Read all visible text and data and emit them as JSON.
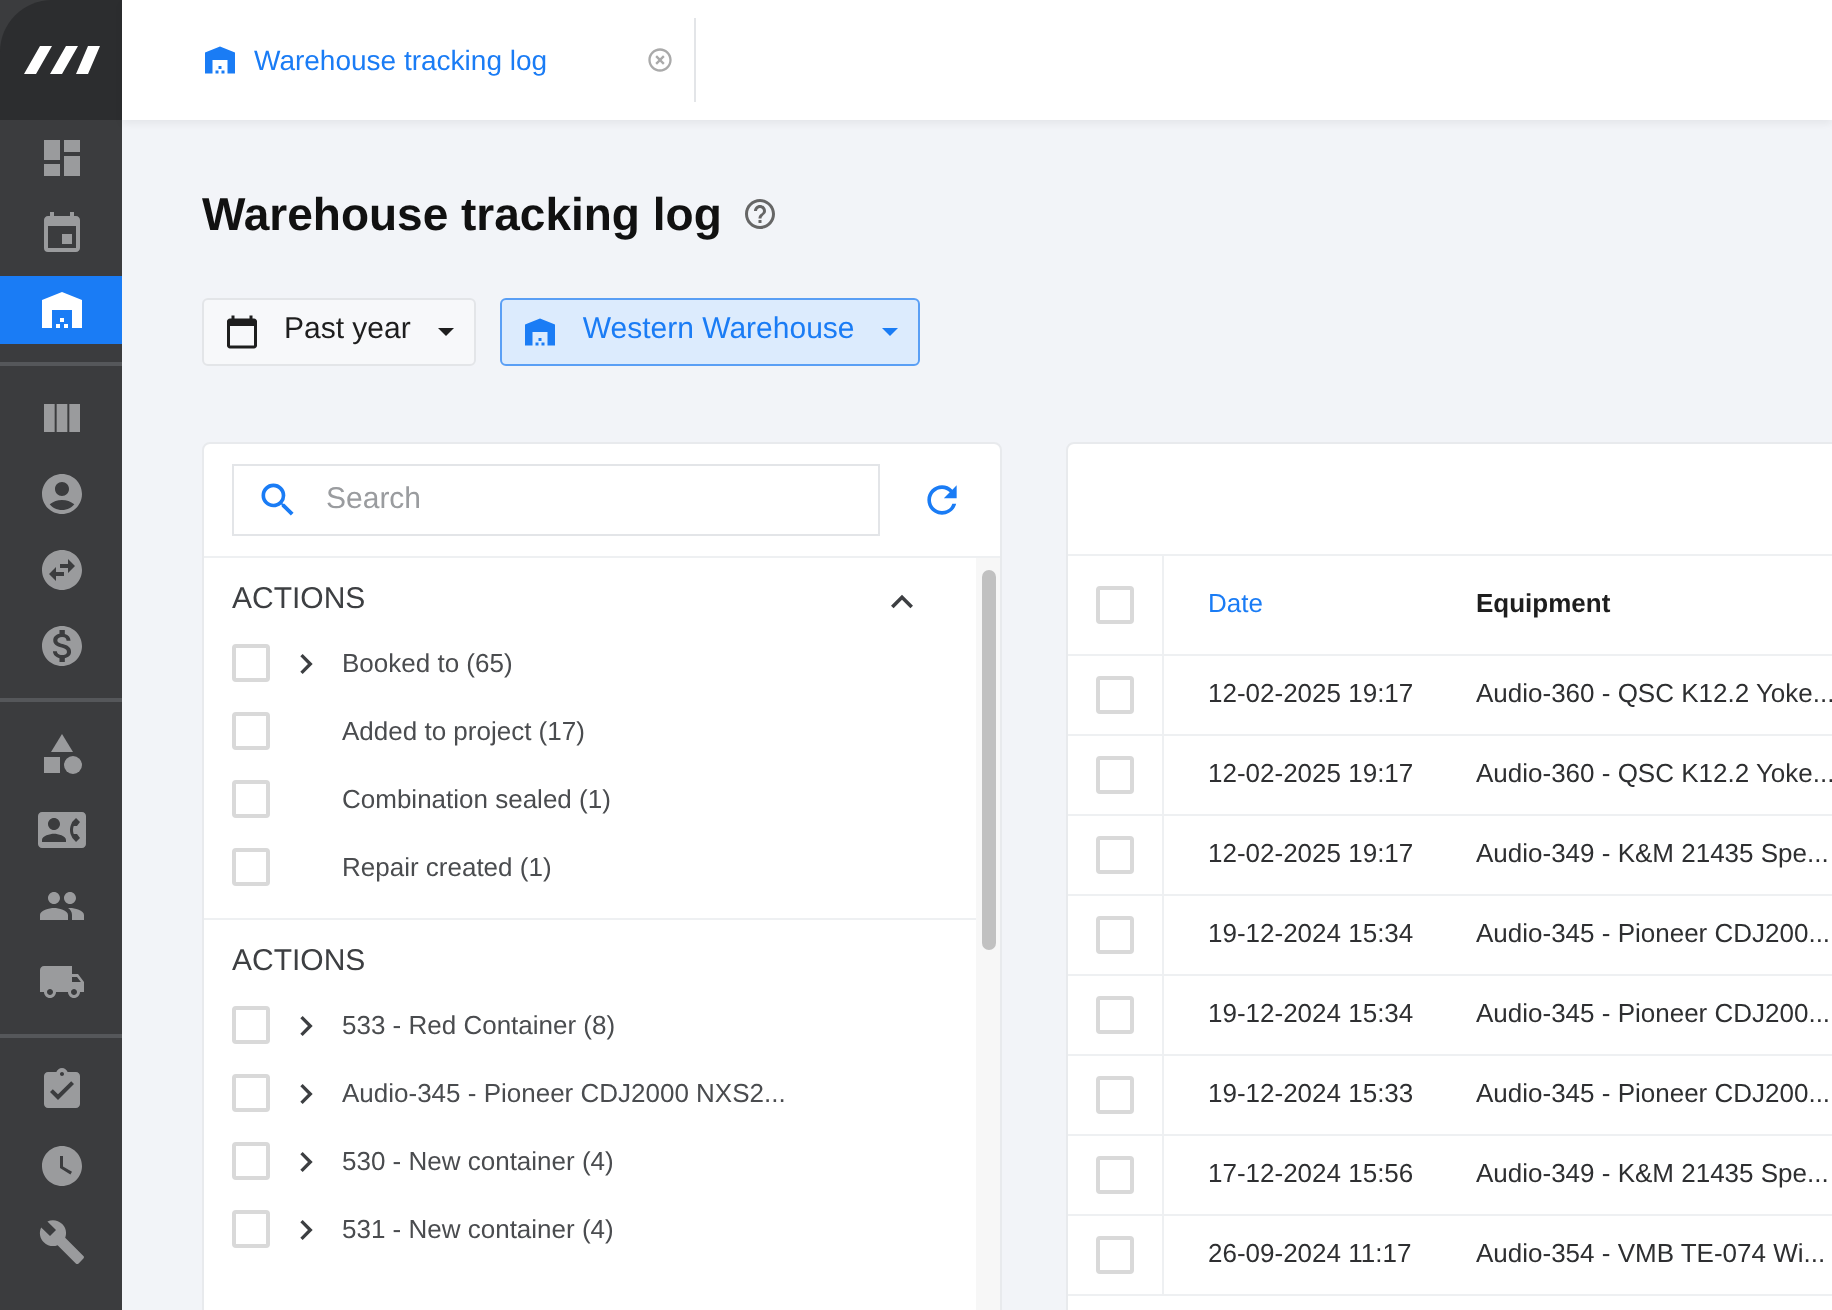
{
  "sidebar": {
    "items": [
      {
        "kind": "dashboard",
        "selected": false
      },
      {
        "kind": "calendar",
        "selected": false
      },
      {
        "kind": "warehouse",
        "selected": true
      },
      {
        "kind": "divider"
      },
      {
        "kind": "columns",
        "selected": false
      },
      {
        "kind": "account",
        "selected": false
      },
      {
        "kind": "swap",
        "selected": false
      },
      {
        "kind": "dollar",
        "selected": false
      },
      {
        "kind": "divider"
      },
      {
        "kind": "shapes",
        "selected": false
      },
      {
        "kind": "contact",
        "selected": false
      },
      {
        "kind": "people",
        "selected": false
      },
      {
        "kind": "truck",
        "selected": false
      },
      {
        "kind": "divider"
      },
      {
        "kind": "clipboard",
        "selected": false
      },
      {
        "kind": "clock",
        "selected": false
      },
      {
        "kind": "wrench",
        "selected": false
      }
    ]
  },
  "tabs": [
    {
      "label": "Warehouse tracking log",
      "selected": true
    }
  ],
  "page": {
    "title": "Warehouse tracking log"
  },
  "filters": [
    {
      "kind": "period",
      "label": "Past year",
      "selected": false
    },
    {
      "kind": "warehouse",
      "label": "Western Warehouse",
      "selected": true
    }
  ],
  "filter_panel": {
    "search": {
      "placeholder": "Search"
    },
    "sections": [
      {
        "title": "ACTIONS",
        "expanded": true,
        "items": [
          {
            "label": "Booked to (65)",
            "checked": false,
            "expandable": true
          },
          {
            "label": "Added to project (17)",
            "checked": false,
            "expandable": false
          },
          {
            "label": "Combination sealed (1)",
            "checked": false,
            "expandable": false
          },
          {
            "label": "Repair created (1)",
            "checked": false,
            "expandable": false
          }
        ]
      },
      {
        "title": "ACTIONS",
        "items": [
          {
            "label": "533 - Red Container (8)",
            "checked": false,
            "expandable": true
          },
          {
            "label": "Audio-345 - Pioneer CDJ2000 NXS2...",
            "checked": false,
            "expandable": true
          },
          {
            "label": "530 - New container (4)",
            "checked": false,
            "expandable": true
          },
          {
            "label": "531 - New container (4)",
            "checked": false,
            "expandable": true
          }
        ]
      }
    ]
  },
  "table": {
    "all_checked": false,
    "columns": [
      {
        "label": "Date",
        "sorted": true
      },
      {
        "label": "Equipment",
        "sorted": false
      }
    ],
    "rows": [
      {
        "date": "12-02-2025 19:17",
        "equipment": "Audio-360 - QSC K12.2 Yoke...",
        "checked": false
      },
      {
        "date": "12-02-2025 19:17",
        "equipment": "Audio-360 - QSC K12.2 Yoke...",
        "checked": false
      },
      {
        "date": "12-02-2025 19:17",
        "equipment": "Audio-349 - K&M 21435 Spe...",
        "checked": false
      },
      {
        "date": "19-12-2024 15:34",
        "equipment": "Audio-345 - Pioneer CDJ200...",
        "checked": false
      },
      {
        "date": "19-12-2024 15:34",
        "equipment": "Audio-345 - Pioneer CDJ200...",
        "checked": false
      },
      {
        "date": "19-12-2024 15:33",
        "equipment": "Audio-345 - Pioneer CDJ200...",
        "checked": false
      },
      {
        "date": "17-12-2024 15:56",
        "equipment": "Audio-349 - K&M 21435 Spe...",
        "checked": false
      },
      {
        "date": "26-09-2024 11:17",
        "equipment": "Audio-354 - VMB TE-074 Wi...",
        "checked": false
      }
    ]
  }
}
